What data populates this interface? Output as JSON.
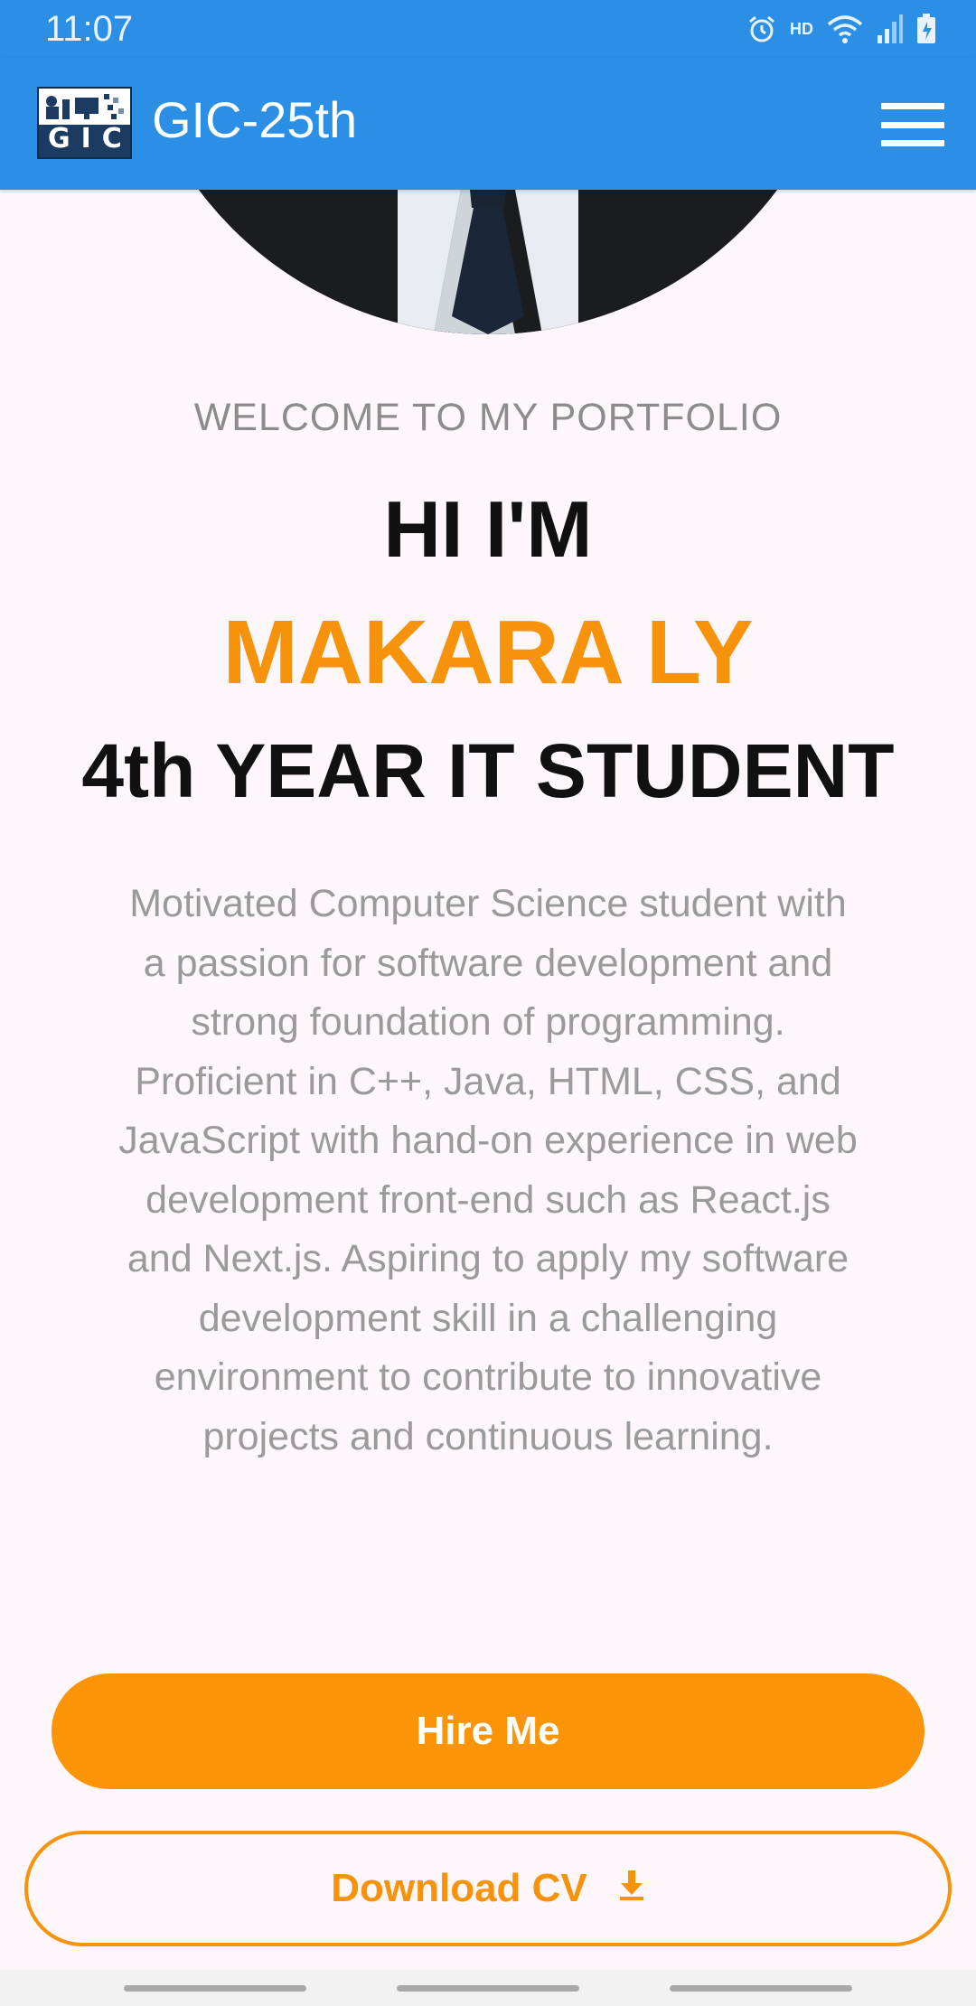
{
  "status_bar": {
    "time": "11:07",
    "hd": "HD"
  },
  "app_bar": {
    "title": "GIC-25th",
    "logo_text": "GIC"
  },
  "hero": {
    "welcome": "WELCOME TO MY PORTFOLIO",
    "greeting": "HI I'M",
    "name": "MAKARA LY",
    "role": "4th YEAR IT STUDENT",
    "bio": "Motivated Computer Science student with a passion for software development and strong foundation of programming. Proficient in C++, Java, HTML, CSS, and JavaScript with hand-on experience in web development front-end such as React.js and Next.js. Aspiring to apply my software development skill in a challenging environment to contribute to innovative projects and continuous learning."
  },
  "buttons": {
    "hire": "Hire Me",
    "download_cv": "Download CV"
  },
  "icons": {
    "menu": "hamburger-menu-icon",
    "download": "download-icon",
    "alarm": "alarm-icon",
    "wifi": "wifi-icon",
    "signal": "signal-icon",
    "battery": "battery-charging-icon"
  },
  "colors": {
    "primary": "#2a8fe5",
    "accent": "#fb9406",
    "background": "#fdf7fb"
  }
}
